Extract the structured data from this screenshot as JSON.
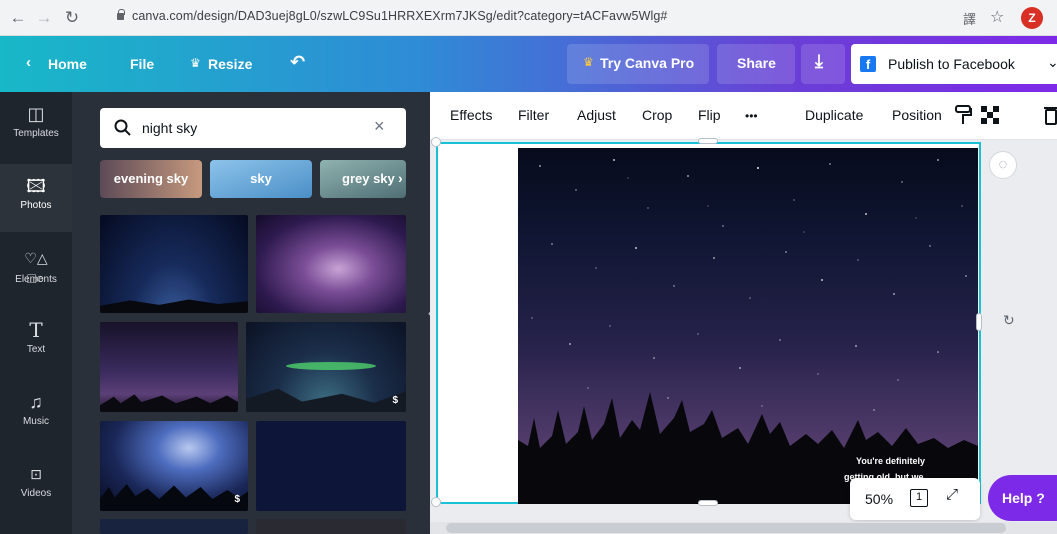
{
  "browser": {
    "url": "canva.com/design/DAD3uej8gL0/szwLC9Su1HRRXEXrm7JKSg/edit?category=tACFavw5Wlg#",
    "avatar_letter": "Z"
  },
  "topbar": {
    "home_label": "Home",
    "file_label": "File",
    "resize_label": "Resize",
    "try_pro_label": "Try Canva Pro",
    "share_label": "Share",
    "publish_label": "Publish to Facebook",
    "accent_color": "#7d2ae8"
  },
  "rail": {
    "items": [
      {
        "label": "Templates",
        "icon": "templates-icon"
      },
      {
        "label": "Photos",
        "icon": "photos-icon"
      },
      {
        "label": "Elements",
        "icon": "elements-icon"
      },
      {
        "label": "Text",
        "icon": "text-icon"
      },
      {
        "label": "Music",
        "icon": "music-icon"
      },
      {
        "label": "Videos",
        "icon": "videos-icon"
      }
    ],
    "active": "Photos"
  },
  "panel": {
    "search_value": "night sky",
    "chips": [
      "evening sky",
      "sky",
      "grey sky"
    ],
    "pro_badge": "$"
  },
  "toolbar": {
    "effects": "Effects",
    "filter": "Filter",
    "adjust": "Adjust",
    "crop": "Crop",
    "flip": "Flip",
    "more": "•••",
    "duplicate": "Duplicate",
    "position": "Position"
  },
  "canvas": {
    "overlay_line1": "You're definitely",
    "overlay_line2": "getting old, but we"
  },
  "zoom": {
    "value": "50%",
    "page_count": "1"
  },
  "help": {
    "label": "Help ?"
  }
}
